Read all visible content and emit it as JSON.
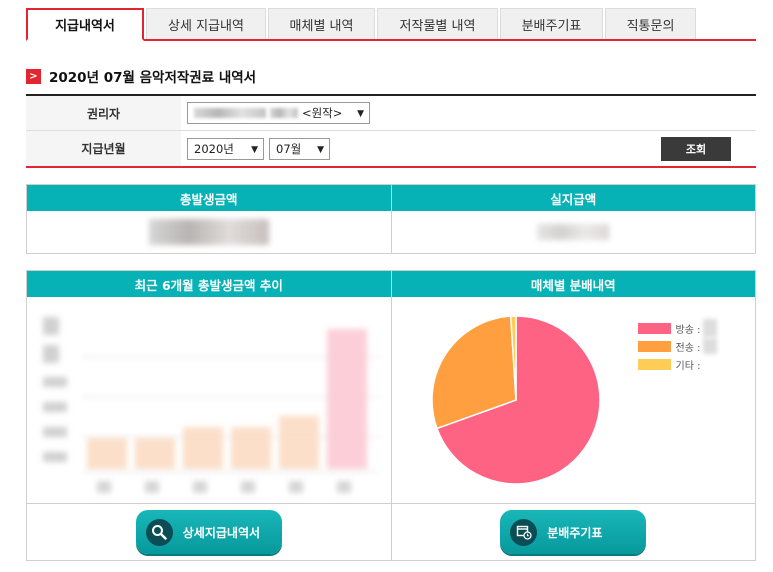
{
  "tabs": [
    {
      "label": "지급내역서",
      "active": true
    },
    {
      "label": "상세 지급내역",
      "active": false
    },
    {
      "label": "매체별 내역",
      "active": false
    },
    {
      "label": "저작물별 내역",
      "active": false
    },
    {
      "label": "분배주기표",
      "active": false
    },
    {
      "label": "직통문의",
      "active": false
    }
  ],
  "title": {
    "mark": ">",
    "text": "2020년 07월 음악저작권료 내역서"
  },
  "form": {
    "rights_label": "권리자",
    "rights_value_suffix": "<원작>",
    "month_label": "지급년월",
    "year_value": "2020년",
    "month_value": "07월",
    "search_button": "조회"
  },
  "summary": {
    "total_label": "총발생금액",
    "actual_label": "실지급액"
  },
  "trend_panel": {
    "title": "최근 6개월 총발생금액 추이"
  },
  "media_panel": {
    "title": "매체별 분배내역"
  },
  "buttons": {
    "detail_statement": "상세지급내역서",
    "schedule": "분배주기표"
  },
  "legend": [
    {
      "label": "방송 :",
      "color": "#ff6384"
    },
    {
      "label": "전송 :",
      "color": "#ff9f40"
    },
    {
      "label": "기타 :",
      "color": "#ffcd56"
    }
  ],
  "chart_data": [
    {
      "type": "pie",
      "title": "매체별 분배내역",
      "labels": [
        "방송",
        "전송",
        "기타"
      ],
      "values": [
        69.5,
        29.5,
        1.0
      ],
      "colors": [
        "#ff6384",
        "#ff9f40",
        "#ffcd56"
      ]
    },
    {
      "type": "bar",
      "title": "최근 6개월 총발생금액 추이",
      "categories": [
        "",
        "",
        "",
        "",
        "",
        ""
      ],
      "series": [
        {
          "values": [
            0.22,
            0.22,
            0.3,
            0.3,
            0.38,
            1.0
          ],
          "color": "#fcd9c0"
        }
      ]
    }
  ]
}
